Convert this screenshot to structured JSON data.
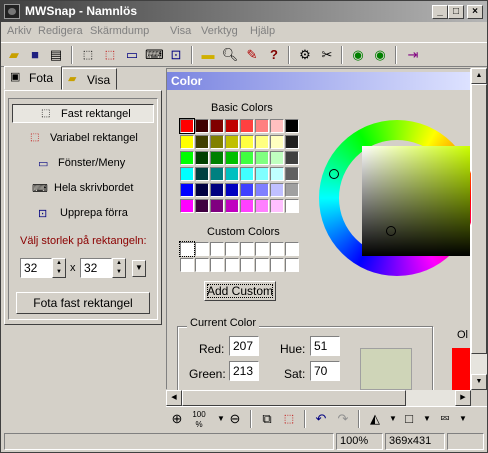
{
  "window": {
    "title": "MWSnap - Namnlös"
  },
  "menu": [
    "Arkiv",
    "Redigera",
    "Skärmdump",
    "Visa",
    "Verktyg",
    "Hjälp"
  ],
  "tabs": [
    {
      "label": "Fota"
    },
    {
      "label": "Visa"
    }
  ],
  "left": {
    "items": [
      {
        "label": "Fast rektangel",
        "icon": "fixed-rect-icon"
      },
      {
        "label": "Variabel rektangel",
        "icon": "variable-rect-icon"
      },
      {
        "label": "Fönster/Meny",
        "icon": "window-menu-icon"
      },
      {
        "label": "Hela skrivbordet",
        "icon": "desktop-icon"
      },
      {
        "label": "Upprepa förra",
        "icon": "repeat-icon"
      }
    ],
    "size_label": "Välj storlek på rektangeln:",
    "width_value": "32",
    "separator": "x",
    "height_value": "32",
    "snap_button": "Fota fast rektangel"
  },
  "color_dialog": {
    "title": "Color",
    "basic_label": "Basic Colors",
    "custom_label": "Custom Colors",
    "add_custom_button": "Add Custom",
    "current_color_label": "Current Color",
    "red_label": "Red:",
    "red_value": "207",
    "green_label": "Green:",
    "green_value": "213",
    "hue_label": "Hue:",
    "hue_value": "51",
    "sat_label": "Sat:",
    "sat_value": "70",
    "old_label": "Ol",
    "current_color": "#cfd5b8",
    "basic_colors": [
      [
        "#ff0000",
        "#400000",
        "#800000",
        "#c00000",
        "#ff4040",
        "#ff8080",
        "#ffc0c0",
        "#000000"
      ],
      [
        "#ffff00",
        "#404000",
        "#808000",
        "#c0c000",
        "#ffff40",
        "#ffff80",
        "#ffffc0",
        "#202020"
      ],
      [
        "#00ff00",
        "#004000",
        "#008000",
        "#00c000",
        "#40ff40",
        "#80ff80",
        "#c0ffc0",
        "#404040"
      ],
      [
        "#00ffff",
        "#004040",
        "#008080",
        "#00c0c0",
        "#40ffff",
        "#80ffff",
        "#c0ffff",
        "#606060"
      ],
      [
        "#0000ff",
        "#000040",
        "#000080",
        "#0000c0",
        "#4040ff",
        "#8080ff",
        "#c0c0ff",
        "#a0a0a0"
      ],
      [
        "#ff00ff",
        "#400040",
        "#800080",
        "#c000c0",
        "#ff40ff",
        "#ff80ff",
        "#ffc0ff",
        "#ffffff"
      ]
    ]
  },
  "status": {
    "zoom": "100%",
    "size": "369x431"
  }
}
